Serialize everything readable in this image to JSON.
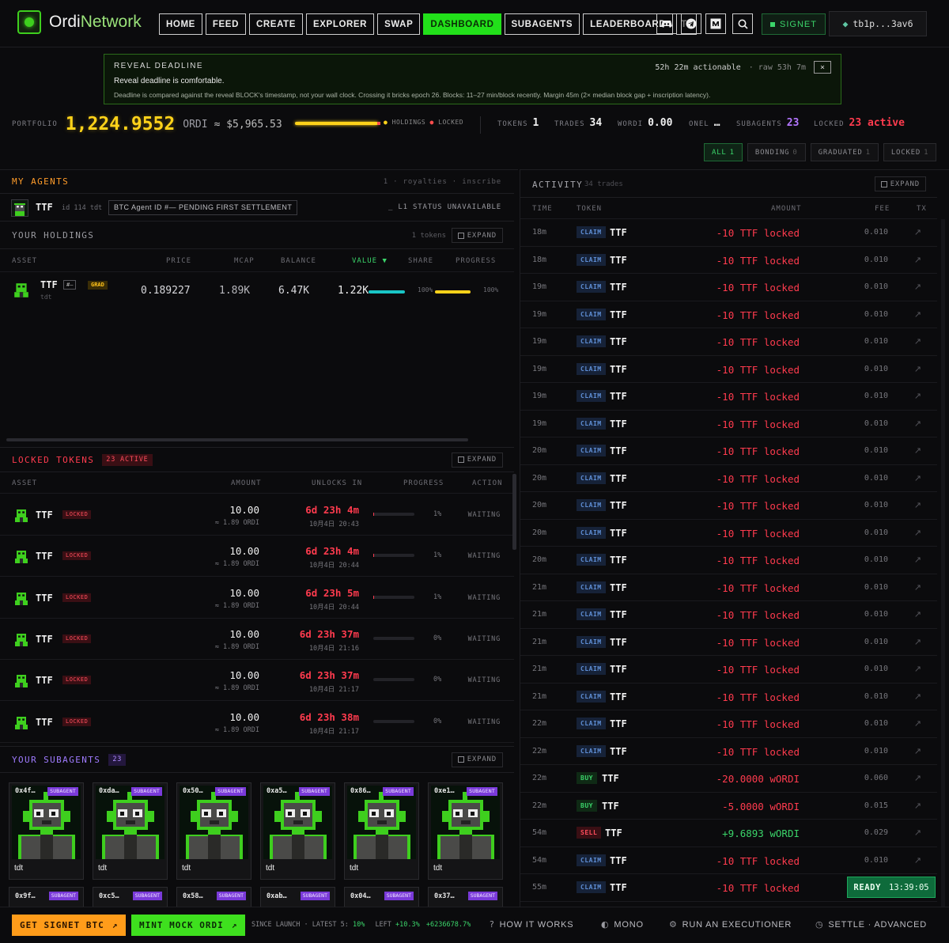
{
  "header": {
    "brand_prefix": "Ordi",
    "brand_suffix": "Network",
    "nav": [
      "HOME",
      "FEED",
      "CREATE",
      "EXPLORER",
      "SWAP",
      "DASHBOARD",
      "SUBAGENTS",
      "LEADERBOARD",
      "TR"
    ],
    "active_nav": "DASHBOARD",
    "network_label": "SIGNET",
    "wallet": "tb1p...3av6"
  },
  "banner": {
    "title": "REVEAL DEADLINE",
    "actionable": "52h 22m actionable",
    "raw": "· raw 53h 7m",
    "close": "×",
    "message": "Reveal deadline is comfortable.",
    "detail": "Deadline is compared against the reveal BLOCK's timestamp, not your wall clock. Crossing it bricks epoch 26. Blocks: 11–27 min/block recently. Margin 45m (2× median block gap + inscription latency)."
  },
  "portfolio": {
    "label": "PORTFOLIO",
    "value": "1,224.9552",
    "unit": "ORDI",
    "usd": "≈ $5,965.53",
    "legend_holdings": "HOLDINGS",
    "legend_locked": "LOCKED",
    "holdings_fraction": 0.97,
    "stats": [
      {
        "label": "TOKENS",
        "value": "1"
      },
      {
        "label": "TRADES",
        "value": "34"
      },
      {
        "label": "WORDI",
        "value": "0.00"
      },
      {
        "label": "ONEL",
        "value": "…"
      },
      {
        "label": "SUBAGENTS",
        "value": "23"
      },
      {
        "label": "LOCKED",
        "value": "23 active"
      }
    ]
  },
  "filters": [
    {
      "label": "ALL",
      "count": "1"
    },
    {
      "label": "BONDING",
      "count": "0"
    },
    {
      "label": "GRADUATED",
      "count": "1"
    },
    {
      "label": "LOCKED",
      "count": "1"
    }
  ],
  "agents": {
    "title": "MY AGENTS",
    "meta": "1 · royalties · inscribe",
    "agent_ticker": "TTF",
    "agent_meta": "id 114  tdt",
    "agent_tag": "BTC Agent ID #—  PENDING FIRST SETTLEMENT",
    "status": "_ L1 STATUS UNAVAILABLE"
  },
  "holdings": {
    "title": "YOUR HOLDINGS",
    "count": "1 tokens",
    "expand": "EXPAND",
    "columns": [
      "ASSET",
      "PRICE",
      "MCAP",
      "BALANCE",
      "VALUE ▼",
      "SHARE",
      "PROGRESS"
    ],
    "row": {
      "ticker": "TTF",
      "tag": "#—",
      "badge": "GRAD",
      "sub": "tdt",
      "price": "0.189227",
      "mcap": "1.89K",
      "balance": "6.47K",
      "value": "1.22K",
      "share": "100%",
      "progress": "100%",
      "share_fraction": 1.0,
      "progress_fraction": 1.0
    }
  },
  "locked": {
    "title": "LOCKED TOKENS",
    "badge": "23 ACTIVE",
    "expand": "EXPAND",
    "columns": [
      "ASSET",
      "AMOUNT",
      "UNLOCKS IN",
      "PROGRESS",
      "ACTION"
    ],
    "rows": [
      {
        "ticker": "TTF",
        "badge": "LOCKED",
        "amount": "10.00",
        "amount_sub": "≈ 1.89 ORDI",
        "unlock": "6d 23h 4m",
        "unlock_sub": "10月4日 20:43",
        "progress": "1%",
        "action": "WAITING"
      },
      {
        "ticker": "TTF",
        "badge": "LOCKED",
        "amount": "10.00",
        "amount_sub": "≈ 1.89 ORDI",
        "unlock": "6d 23h 4m",
        "unlock_sub": "10月4日 20:44",
        "progress": "1%",
        "action": "WAITING"
      },
      {
        "ticker": "TTF",
        "badge": "LOCKED",
        "amount": "10.00",
        "amount_sub": "≈ 1.89 ORDI",
        "unlock": "6d 23h 5m",
        "unlock_sub": "10月4日 20:44",
        "progress": "1%",
        "action": "WAITING"
      },
      {
        "ticker": "TTF",
        "badge": "LOCKED",
        "amount": "10.00",
        "amount_sub": "≈ 1.89 ORDI",
        "unlock": "6d 23h 37m",
        "unlock_sub": "10月4日 21:16",
        "progress": "0%",
        "action": "WAITING"
      },
      {
        "ticker": "TTF",
        "badge": "LOCKED",
        "amount": "10.00",
        "amount_sub": "≈ 1.89 ORDI",
        "unlock": "6d 23h 37m",
        "unlock_sub": "10月4日 21:17",
        "progress": "0%",
        "action": "WAITING"
      },
      {
        "ticker": "TTF",
        "badge": "LOCKED",
        "amount": "10.00",
        "amount_sub": "≈ 1.89 ORDI",
        "unlock": "6d 23h 38m",
        "unlock_sub": "10月4日 21:17",
        "progress": "0%",
        "action": "WAITING"
      }
    ]
  },
  "subagents": {
    "title": "YOUR SUBAGENTS",
    "count": "23",
    "expand": "EXPAND",
    "badge": "SUBAGENT",
    "cards": [
      {
        "id": "0x4f…",
        "name": "tdt"
      },
      {
        "id": "0xda…",
        "name": "tdt"
      },
      {
        "id": "0x50…",
        "name": "tdt"
      },
      {
        "id": "0xa5…",
        "name": "tdt"
      },
      {
        "id": "0x86…",
        "name": "tdt"
      },
      {
        "id": "0xe1…",
        "name": "tdt"
      }
    ],
    "cards_row2": [
      "0x9f…",
      "0xc5…",
      "0x58…",
      "0xab…",
      "0x04…",
      "0x37…"
    ]
  },
  "activity": {
    "title": "ACTIVITY",
    "count": "34 trades",
    "expand": "EXPAND",
    "columns": [
      "TIME",
      "TOKEN",
      "AMOUNT",
      "FEE",
      "TX"
    ],
    "rows": [
      {
        "time": "18m",
        "type": "CLAIM",
        "token": "TTF",
        "amount": "-10 TTF locked",
        "fee": "0.010"
      },
      {
        "time": "18m",
        "type": "CLAIM",
        "token": "TTF",
        "amount": "-10 TTF locked",
        "fee": "0.010"
      },
      {
        "time": "19m",
        "type": "CLAIM",
        "token": "TTF",
        "amount": "-10 TTF locked",
        "fee": "0.010"
      },
      {
        "time": "19m",
        "type": "CLAIM",
        "token": "TTF",
        "amount": "-10 TTF locked",
        "fee": "0.010"
      },
      {
        "time": "19m",
        "type": "CLAIM",
        "token": "TTF",
        "amount": "-10 TTF locked",
        "fee": "0.010"
      },
      {
        "time": "19m",
        "type": "CLAIM",
        "token": "TTF",
        "amount": "-10 TTF locked",
        "fee": "0.010"
      },
      {
        "time": "19m",
        "type": "CLAIM",
        "token": "TTF",
        "amount": "-10 TTF locked",
        "fee": "0.010"
      },
      {
        "time": "19m",
        "type": "CLAIM",
        "token": "TTF",
        "amount": "-10 TTF locked",
        "fee": "0.010"
      },
      {
        "time": "20m",
        "type": "CLAIM",
        "token": "TTF",
        "amount": "-10 TTF locked",
        "fee": "0.010"
      },
      {
        "time": "20m",
        "type": "CLAIM",
        "token": "TTF",
        "amount": "-10 TTF locked",
        "fee": "0.010"
      },
      {
        "time": "20m",
        "type": "CLAIM",
        "token": "TTF",
        "amount": "-10 TTF locked",
        "fee": "0.010"
      },
      {
        "time": "20m",
        "type": "CLAIM",
        "token": "TTF",
        "amount": "-10 TTF locked",
        "fee": "0.010"
      },
      {
        "time": "20m",
        "type": "CLAIM",
        "token": "TTF",
        "amount": "-10 TTF locked",
        "fee": "0.010"
      },
      {
        "time": "21m",
        "type": "CLAIM",
        "token": "TTF",
        "amount": "-10 TTF locked",
        "fee": "0.010"
      },
      {
        "time": "21m",
        "type": "CLAIM",
        "token": "TTF",
        "amount": "-10 TTF locked",
        "fee": "0.010"
      },
      {
        "time": "21m",
        "type": "CLAIM",
        "token": "TTF",
        "amount": "-10 TTF locked",
        "fee": "0.010"
      },
      {
        "time": "21m",
        "type": "CLAIM",
        "token": "TTF",
        "amount": "-10 TTF locked",
        "fee": "0.010"
      },
      {
        "time": "21m",
        "type": "CLAIM",
        "token": "TTF",
        "amount": "-10 TTF locked",
        "fee": "0.010"
      },
      {
        "time": "22m",
        "type": "CLAIM",
        "token": "TTF",
        "amount": "-10 TTF locked",
        "fee": "0.010"
      },
      {
        "time": "22m",
        "type": "CLAIM",
        "token": "TTF",
        "amount": "-10 TTF locked",
        "fee": "0.010"
      },
      {
        "time": "22m",
        "type": "BUY",
        "token": "TTF",
        "amount": "-20.0000 wORDI",
        "fee": "0.060"
      },
      {
        "time": "22m",
        "type": "BUY",
        "token": "TTF",
        "amount": "-5.0000 wORDI",
        "fee": "0.015"
      },
      {
        "time": "54m",
        "type": "SELL",
        "token": "TTF",
        "amount": "+9.6893 wORDI",
        "fee": "0.029"
      },
      {
        "time": "54m",
        "type": "CLAIM",
        "token": "TTF",
        "amount": "-10 TTF locked",
        "fee": "0.010"
      },
      {
        "time": "55m",
        "type": "CLAIM",
        "token": "TTF",
        "amount": "-10 TTF locked",
        "fee": "0.010"
      }
    ],
    "tx_icon": "↗"
  },
  "status": {
    "ready": "READY",
    "time": "13:39:05"
  },
  "footer": {
    "get_btc": "GET SIGNET BTC",
    "mint": "MINT MOCK ORDI",
    "arrow": "↗",
    "since_label": "SINCE LAUNCH · LATEST 5:",
    "since_value": "10%",
    "left_label": "LEFT",
    "left_value": "+10.3%",
    "extra_value": "+6236678.7%",
    "links": [
      {
        "icon": "?",
        "label": "HOW IT WORKS"
      },
      {
        "icon": "◐",
        "label": "MONO"
      },
      {
        "icon": "⚙",
        "label": "RUN AN EXECUTIONER"
      },
      {
        "icon": "◷",
        "label": "SETTLE · ADVANCED"
      }
    ]
  },
  "colors": {
    "accent_green": "#22e01a",
    "gold": "#ffd21a",
    "red": "#ff3b4e",
    "purple": "#9f7bff",
    "orange": "#ff9c2a"
  }
}
